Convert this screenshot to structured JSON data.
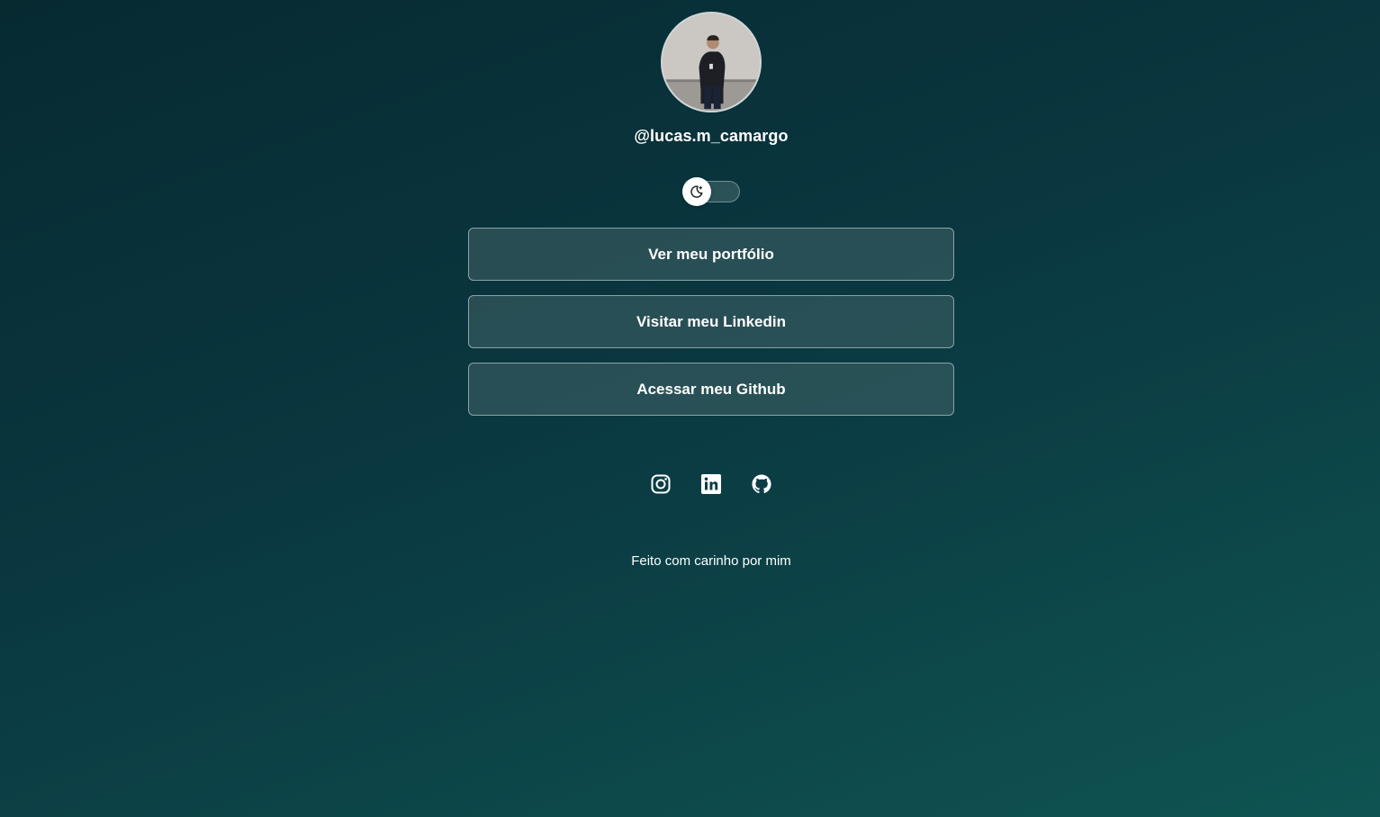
{
  "profile": {
    "handle": "@lucas.m_camargo",
    "avatar_alt": "profile-photo"
  },
  "theme_toggle": {
    "icon": "moon-icon",
    "state": "dark"
  },
  "links": [
    {
      "label": "Ver meu portfólio"
    },
    {
      "label": "Visitar meu Linkedin"
    },
    {
      "label": "Acessar meu Github"
    }
  ],
  "social": [
    {
      "icon": "instagram-icon"
    },
    {
      "icon": "linkedin-icon"
    },
    {
      "icon": "github-icon"
    }
  ],
  "footer": {
    "text": "Feito com carinho por mim"
  },
  "colors": {
    "background_start": "#072a31",
    "background_end": "#0f5452",
    "button_fill": "#2e555a",
    "button_border": "#8aa3a6",
    "text": "#ffffff"
  }
}
